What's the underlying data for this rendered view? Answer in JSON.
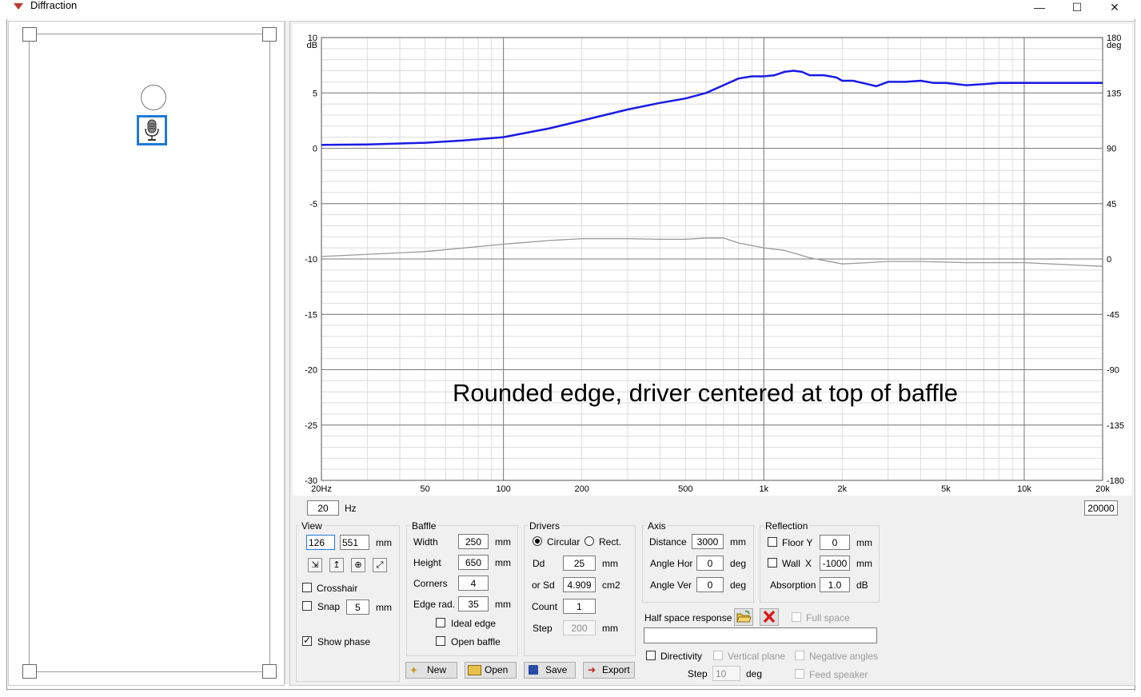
{
  "window": {
    "title": "Diffraction",
    "minimize": "—",
    "maximize": "☐",
    "close": "✕"
  },
  "annotation": "Rounded edge, driver centered at top of baffle",
  "chart_data": {
    "type": "line",
    "x_scale": "log",
    "xlim": [
      20,
      20000
    ],
    "ylim": [
      -30,
      10
    ],
    "y2lim": [
      -180,
      180
    ],
    "ylabel_unit": "dB",
    "y2label_unit": "deg",
    "x_ticks": [
      20,
      50,
      100,
      200,
      500,
      1000,
      2000,
      5000,
      10000,
      20000
    ],
    "x_tick_labels": [
      "20Hz",
      "50",
      "100",
      "200",
      "500",
      "1k",
      "2k",
      "5k",
      "10k",
      "20k"
    ],
    "y_ticks": [
      10,
      5,
      0,
      -5,
      -10,
      -15,
      -20,
      -25,
      -30
    ],
    "y_tick_labels": [
      "10",
      "5",
      "0",
      "-5",
      "-10",
      "-15",
      "-20",
      "-25",
      "-30"
    ],
    "y2_ticks": [
      180,
      135,
      90,
      45,
      0,
      -45,
      -90,
      -135,
      -180
    ],
    "y2_tick_labels": [
      "180",
      "135",
      "90",
      "45",
      "0",
      "-45",
      "-90",
      "-135",
      "-180"
    ],
    "grid": true,
    "series": [
      {
        "color": "#1a1ae6",
        "axis": "left",
        "x": [
          20,
          30,
          50,
          70,
          100,
          150,
          200,
          300,
          400,
          500,
          600,
          700,
          800,
          900,
          1000,
          1100,
          1200,
          1300,
          1400,
          1500,
          1700,
          1900,
          2000,
          2200,
          2500,
          2700,
          3000,
          3500,
          4000,
          4500,
          5000,
          6000,
          7000,
          8000,
          10000,
          15000,
          20000
        ],
        "y": [
          0.3,
          0.35,
          0.5,
          0.7,
          1.0,
          1.8,
          2.5,
          3.5,
          4.1,
          4.5,
          5.0,
          5.7,
          6.3,
          6.5,
          6.5,
          6.6,
          6.9,
          7.0,
          6.9,
          6.6,
          6.6,
          6.4,
          6.1,
          6.1,
          5.8,
          5.6,
          6.0,
          6.0,
          6.1,
          5.9,
          5.9,
          5.7,
          5.8,
          5.9,
          5.9,
          5.9,
          5.9
        ]
      },
      {
        "color": "#999999",
        "axis": "right",
        "x": [
          20,
          50,
          100,
          150,
          200,
          300,
          400,
          500,
          600,
          700,
          800,
          1000,
          1200,
          1500,
          2000,
          2500,
          3000,
          4000,
          6000,
          10000,
          20000
        ],
        "y": [
          2,
          6,
          12,
          15,
          16.5,
          16.5,
          16,
          16,
          17,
          17,
          13,
          9,
          7,
          1,
          -4,
          -3,
          -2,
          -2,
          -3,
          -3,
          -6
        ]
      }
    ]
  },
  "range": {
    "min": "20",
    "min_unit": "Hz",
    "max": "20000"
  },
  "view": {
    "title": "View",
    "x": "126",
    "y": "551",
    "unit": "mm",
    "tools": [
      "⇲",
      "↥",
      "⊕",
      "⤢"
    ],
    "crosshair": "Crosshair",
    "snap": "Snap",
    "snap_value": "5",
    "snap_unit": "mm",
    "show_phase": "Show phase"
  },
  "baffle": {
    "title": "Baffle",
    "width_label": "Width",
    "width": "250",
    "width_unit": "mm",
    "height_label": "Height",
    "height": "650",
    "height_unit": "mm",
    "corners_label": "Corners",
    "corners": "4",
    "edge_label": "Edge rad.",
    "edge": "35",
    "edge_unit": "mm",
    "ideal_edge": "Ideal edge",
    "open_baffle": "Open baffle"
  },
  "drivers": {
    "title": "Drivers",
    "circular": "Circular",
    "rect": "Rect.",
    "dd_label": "Dd",
    "dd": "25",
    "dd_unit": "mm",
    "sd_label": "or Sd",
    "sd": "4.909",
    "sd_unit": "cm2",
    "count_label": "Count",
    "count": "1",
    "step_label": "Step",
    "step": "200",
    "step_unit": "mm"
  },
  "axis": {
    "title": "Axis",
    "distance_label": "Distance",
    "distance": "3000",
    "distance_unit": "mm",
    "hor_label": "Angle Hor",
    "hor": "0",
    "hor_unit": "deg",
    "ver_label": "Angle Ver",
    "ver": "0",
    "ver_unit": "deg"
  },
  "reflection": {
    "title": "Reflection",
    "floor_label": "Floor Y",
    "floor": "0",
    "floor_unit": "mm",
    "wall_label": "Wall",
    "wall_x": "X",
    "wall": "-1000",
    "wall_unit": "mm",
    "absorption_label": "Absorption",
    "absorption": "1.0",
    "absorption_unit": "dB"
  },
  "half_space": {
    "label": "Half space response",
    "full_space": "Full space",
    "path": ""
  },
  "directivity": {
    "label": "Directivity",
    "vertical_plane": "Vertical plane",
    "negative_angles": "Negative angles",
    "step_label": "Step",
    "step": "10",
    "step_unit": "deg",
    "feed_speaker": "Feed speaker"
  },
  "buttons": {
    "new": "New",
    "open": "Open",
    "save": "Save",
    "export": "Export"
  }
}
